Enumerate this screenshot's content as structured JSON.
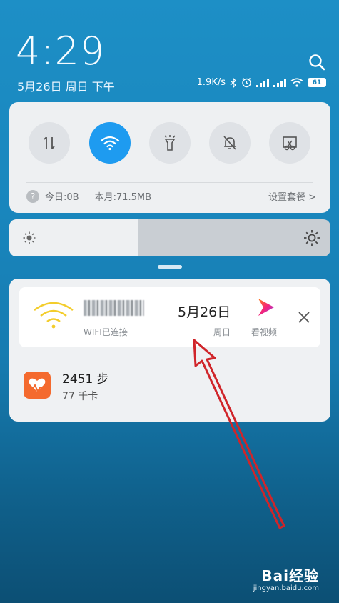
{
  "header": {
    "time": "4:29",
    "date": "5月26日 周日 下午"
  },
  "status_bar": {
    "net_speed": "1.9K/s",
    "battery": "61"
  },
  "quick_settings": {
    "tiles": [
      {
        "name": "mobile-data",
        "active": false
      },
      {
        "name": "wifi",
        "active": true
      },
      {
        "name": "flashlight",
        "active": false
      },
      {
        "name": "mute",
        "active": false
      },
      {
        "name": "screenshot",
        "active": false
      }
    ],
    "data_today": "今日:0B",
    "data_month": "本月:71.5MB",
    "plan_link": "设置套餐 >"
  },
  "brightness": {
    "level": 0.4
  },
  "notifications": {
    "wifi": {
      "status": "WIFI已连接",
      "date": "5月26日",
      "weekday": "周日",
      "video_label": "看视频"
    },
    "health": {
      "steps": "2451 步",
      "calories": "77 千卡"
    }
  },
  "watermark": {
    "brand": "Bai经验",
    "url": "jingyan.baidu.com"
  },
  "colors": {
    "accent": "#1e9bf0",
    "panel": "#eef0f2",
    "annotation_arrow": "#d0252a"
  }
}
